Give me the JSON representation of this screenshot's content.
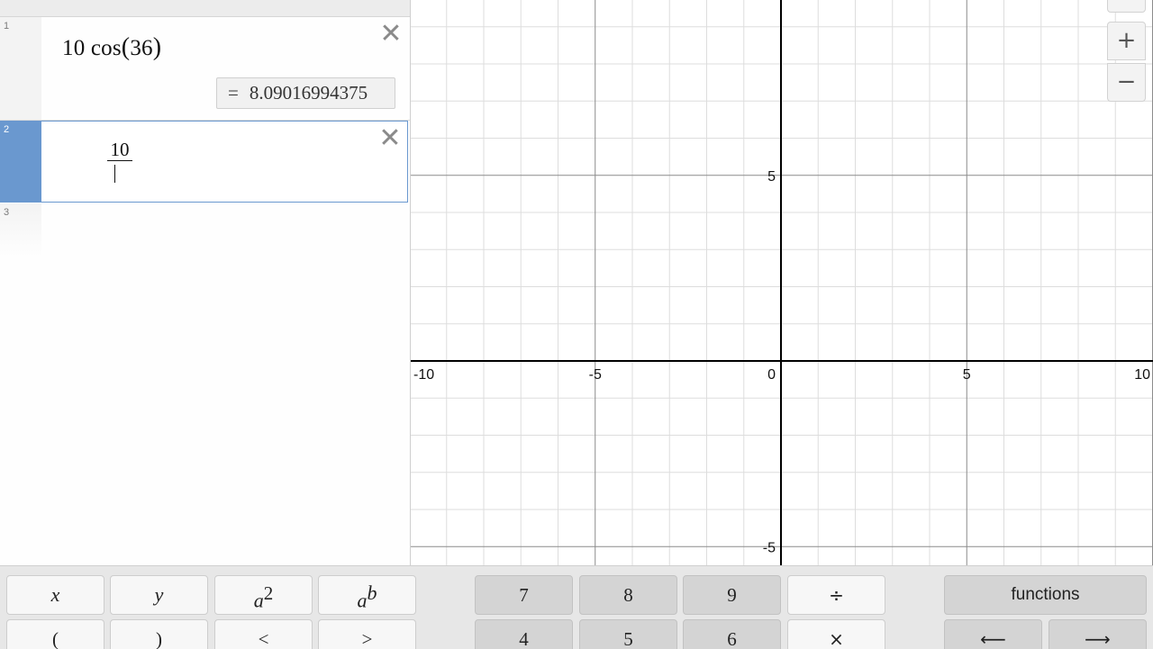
{
  "expressions": [
    {
      "index": "1",
      "parts": {
        "coef": "10",
        "func": "cos",
        "open": "(",
        "arg": "36",
        "close": ")"
      },
      "result_eq": "=",
      "result_value": "8.09016994375"
    },
    {
      "index": "2",
      "fraction_numerator": "10"
    },
    {
      "index": "3"
    }
  ],
  "graph": {
    "x_ticks": [
      "-10",
      "-5",
      "0",
      "5",
      "10"
    ],
    "y_ticks": [
      "5",
      "-5"
    ],
    "x_range": [
      -10,
      10
    ],
    "y_range": [
      -5.5,
      9.7
    ],
    "major_grid_step": 5,
    "minor_grid_step": 1,
    "colors": {
      "axis": "#000000",
      "major_grid": "#8c8c8c",
      "minor_grid": "#dddddd"
    }
  },
  "zoom": {
    "in_label": "+",
    "out_label": "−"
  },
  "keypad": {
    "row1": {
      "x": "x",
      "y": "y",
      "a2_base": "a",
      "a2_exp": "2",
      "ab_base": "a",
      "ab_exp": "b",
      "seven": "7",
      "eight": "8",
      "nine": "9",
      "divide": "÷",
      "functions": "functions"
    },
    "row2": {
      "lparen": "(",
      "rparen": ")",
      "lt": "<",
      "gt": ">",
      "four": "4",
      "five": "5",
      "six": "6",
      "times": "×",
      "left": "⟵",
      "right": "⟶"
    }
  },
  "icons": {
    "delete_expression": "close-icon",
    "cursor": "text-caret-icon"
  }
}
